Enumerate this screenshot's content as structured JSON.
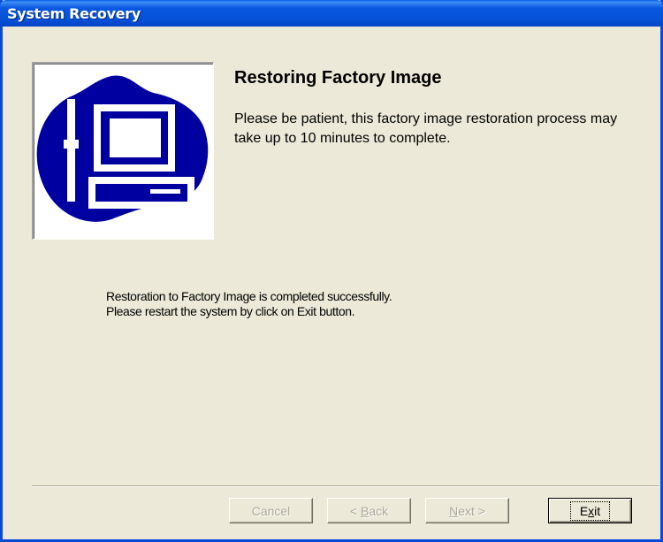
{
  "window": {
    "title": "System Recovery",
    "colors": {
      "titlebar": "#0453d8",
      "face": "#ece9d8",
      "logo_blue": "#0000a0"
    }
  },
  "header": {
    "heading": "Restoring Factory Image",
    "description": "Please be patient, this factory image restoration process may take up to 10 minutes to complete."
  },
  "logo": {
    "icon": "computer-repair-icon"
  },
  "status": {
    "line1": "Restoration to Factory Image is completed successfully.",
    "line2": "Please restart the system by click on Exit button."
  },
  "buttons": {
    "cancel": "Cancel",
    "back_prefix": "< ",
    "back_mnemonic": "B",
    "back_rest": "ack",
    "next_mnemonic": "N",
    "next_rest": "ext >",
    "exit_pre": "E",
    "exit_mnemonic": "x",
    "exit_rest": "it"
  }
}
